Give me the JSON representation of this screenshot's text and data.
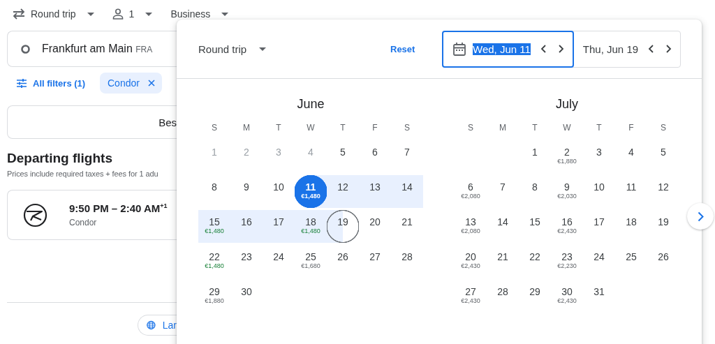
{
  "top_bar": {
    "trip_type": "Round trip",
    "passengers": "1",
    "cabin": "Business"
  },
  "search": {
    "origin": {
      "value": "Frankfurt am Main",
      "code": "FRA"
    }
  },
  "filters": {
    "all_filters": "All filters (1)",
    "chips": [
      {
        "label": "Condor"
      }
    ]
  },
  "sort": {
    "label": "Bes"
  },
  "results": {
    "title": "Departing flights",
    "subtitle": "Prices include required taxes + fees for 1 adu",
    "flights": [
      {
        "times": "9:50 PM – 2:40 AM$^{+1}$",
        "airline": "Condor"
      }
    ]
  },
  "footer": {
    "language_button": "Lar"
  },
  "date_picker": {
    "trip_type": "Round trip",
    "reset": "Reset",
    "fields": [
      {
        "value": "Wed, Jun 11",
        "selected": true
      },
      {
        "value": "Thu, Jun 19",
        "selected": false
      }
    ],
    "months": [
      {
        "name": "June",
        "weekdays": [
          "S",
          "M",
          "T",
          "W",
          "T",
          "F",
          "S"
        ],
        "days": [
          {
            "kind": "day",
            "day": "1",
            "disabled": true,
            "in_range": false,
            "selected": false,
            "outlined": false
          },
          {
            "kind": "day",
            "day": "2",
            "disabled": true,
            "in_range": false,
            "selected": false,
            "outlined": false
          },
          {
            "kind": "day",
            "day": "3",
            "disabled": true,
            "in_range": false,
            "selected": false,
            "outlined": false
          },
          {
            "kind": "day",
            "day": "4",
            "disabled": true,
            "in_range": false,
            "selected": false,
            "outlined": false
          },
          {
            "kind": "day",
            "day": "5",
            "disabled": false,
            "in_range": false,
            "selected": false,
            "outlined": false
          },
          {
            "kind": "day",
            "day": "6",
            "disabled": false,
            "in_range": false,
            "selected": false,
            "outlined": false
          },
          {
            "kind": "day",
            "day": "7",
            "disabled": false,
            "in_range": false,
            "selected": false,
            "outlined": false
          },
          {
            "kind": "day",
            "day": "8",
            "disabled": false,
            "in_range": false,
            "selected": false,
            "outlined": false
          },
          {
            "kind": "day",
            "day": "9",
            "disabled": false,
            "in_range": false,
            "selected": false,
            "outlined": false
          },
          {
            "kind": "day",
            "day": "10",
            "disabled": false,
            "in_range": false,
            "selected": false,
            "outlined": false
          },
          {
            "kind": "day",
            "day": "11",
            "price": {
              "text": "€1,480"
            },
            "disabled": false,
            "in_range": true,
            "selected": true,
            "outlined": false
          },
          {
            "kind": "day",
            "day": "12",
            "disabled": false,
            "in_range": true,
            "selected": false,
            "outlined": false
          },
          {
            "kind": "day",
            "day": "13",
            "disabled": false,
            "in_range": true,
            "selected": false,
            "outlined": false
          },
          {
            "kind": "day",
            "day": "14",
            "disabled": false,
            "in_range": true,
            "selected": false,
            "outlined": false
          },
          {
            "kind": "day",
            "day": "15",
            "price": {
              "text": "€1,480",
              "cheap": true
            },
            "disabled": false,
            "in_range": true,
            "selected": false,
            "outlined": false
          },
          {
            "kind": "day",
            "day": "16",
            "disabled": false,
            "in_range": true,
            "selected": false,
            "outlined": false
          },
          {
            "kind": "day",
            "day": "17",
            "disabled": false,
            "in_range": true,
            "selected": false,
            "outlined": false
          },
          {
            "kind": "day",
            "day": "18",
            "price": {
              "text": "€1,480",
              "cheap": true
            },
            "disabled": false,
            "in_range": true,
            "selected": false,
            "outlined": false
          },
          {
            "kind": "day",
            "day": "19",
            "disabled": false,
            "in_range": true,
            "selected": false,
            "outlined": true
          },
          {
            "kind": "day",
            "day": "20",
            "disabled": false,
            "in_range": false,
            "selected": false,
            "outlined": false
          },
          {
            "kind": "day",
            "day": "21",
            "disabled": false,
            "in_range": false,
            "selected": false,
            "outlined": false
          },
          {
            "kind": "day",
            "day": "22",
            "price": {
              "text": "€1,480",
              "cheap": true
            },
            "disabled": false,
            "in_range": false,
            "selected": false,
            "outlined": false
          },
          {
            "kind": "day",
            "day": "23",
            "disabled": false,
            "in_range": false,
            "selected": false,
            "outlined": false
          },
          {
            "kind": "day",
            "day": "24",
            "disabled": false,
            "in_range": false,
            "selected": false,
            "outlined": false
          },
          {
            "kind": "day",
            "day": "25",
            "price": {
              "text": "€1,680",
              "cheap": false
            },
            "disabled": false,
            "in_range": false,
            "selected": false,
            "outlined": false
          },
          {
            "kind": "day",
            "day": "26",
            "disabled": false,
            "in_range": false,
            "selected": false,
            "outlined": false
          },
          {
            "kind": "day",
            "day": "27",
            "disabled": false,
            "in_range": false,
            "selected": false,
            "outlined": false
          },
          {
            "kind": "day",
            "day": "28",
            "disabled": false,
            "in_range": false,
            "selected": false,
            "outlined": false
          },
          {
            "kind": "day",
            "day": "29",
            "price": {
              "text": "€1,880",
              "cheap": false
            },
            "disabled": false,
            "in_range": false,
            "selected": false,
            "outlined": false
          },
          {
            "kind": "day",
            "day": "30",
            "disabled": false,
            "in_range": false,
            "selected": false,
            "outlined": false
          }
        ]
      },
      {
        "name": "July",
        "weekdays": [
          "S",
          "M",
          "T",
          "W",
          "T",
          "F",
          "S"
        ],
        "days": [
          {
            "kind": "empty"
          },
          {
            "kind": "empty"
          },
          {
            "kind": "day",
            "day": "1",
            "disabled": false,
            "in_range": false,
            "selected": false,
            "outlined": false
          },
          {
            "kind": "day",
            "day": "2",
            "price": {
              "text": "€1,880",
              "cheap": false
            },
            "disabled": false,
            "in_range": false,
            "selected": false,
            "outlined": false
          },
          {
            "kind": "day",
            "day": "3",
            "disabled": false,
            "in_range": false,
            "selected": false,
            "outlined": false
          },
          {
            "kind": "day",
            "day": "4",
            "disabled": false,
            "in_range": false,
            "selected": false,
            "outlined": false
          },
          {
            "kind": "day",
            "day": "5",
            "disabled": false,
            "in_range": false,
            "selected": false,
            "outlined": false
          },
          {
            "kind": "day",
            "day": "6",
            "price": {
              "text": "€2,080",
              "cheap": false
            },
            "disabled": false,
            "in_range": false,
            "selected": false,
            "outlined": false
          },
          {
            "kind": "day",
            "day": "7",
            "disabled": false,
            "in_range": false,
            "selected": false,
            "outlined": false
          },
          {
            "kind": "day",
            "day": "8",
            "disabled": false,
            "in_range": false,
            "selected": false,
            "outlined": false
          },
          {
            "kind": "day",
            "day": "9",
            "price": {
              "text": "€2,030",
              "cheap": false
            },
            "disabled": false,
            "in_range": false,
            "selected": false,
            "outlined": false
          },
          {
            "kind": "day",
            "day": "10",
            "disabled": false,
            "in_range": false,
            "selected": false,
            "outlined": false
          },
          {
            "kind": "day",
            "day": "11",
            "disabled": false,
            "in_range": false,
            "selected": false,
            "outlined": false
          },
          {
            "kind": "day",
            "day": "12",
            "disabled": false,
            "in_range": false,
            "selected": false,
            "outlined": false
          },
          {
            "kind": "day",
            "day": "13",
            "price": {
              "text": "€2,080",
              "cheap": false
            },
            "disabled": false,
            "in_range": false,
            "selected": false,
            "outlined": false
          },
          {
            "kind": "day",
            "day": "14",
            "disabled": false,
            "in_range": false,
            "selected": false,
            "outlined": false
          },
          {
            "kind": "day",
            "day": "15",
            "disabled": false,
            "in_range": false,
            "selected": false,
            "outlined": false
          },
          {
            "kind": "day",
            "day": "16",
            "price": {
              "text": "€2,430",
              "cheap": false
            },
            "disabled": false,
            "in_range": false,
            "selected": false,
            "outlined": false
          },
          {
            "kind": "day",
            "day": "17",
            "disabled": false,
            "in_range": false,
            "selected": false,
            "outlined": false
          },
          {
            "kind": "day",
            "day": "18",
            "disabled": false,
            "in_range": false,
            "selected": false,
            "outlined": false
          },
          {
            "kind": "day",
            "day": "19",
            "disabled": false,
            "in_range": false,
            "selected": false,
            "outlined": false
          },
          {
            "kind": "day",
            "day": "20",
            "price": {
              "text": "€2,430",
              "cheap": false
            },
            "disabled": false,
            "in_range": false,
            "selected": false,
            "outlined": false
          },
          {
            "kind": "day",
            "day": "21",
            "disabled": false,
            "in_range": false,
            "selected": false,
            "outlined": false
          },
          {
            "kind": "day",
            "day": "22",
            "disabled": false,
            "in_range": false,
            "selected": false,
            "outlined": false
          },
          {
            "kind": "day",
            "day": "23",
            "price": {
              "text": "€2,230",
              "cheap": false
            },
            "disabled": false,
            "in_range": false,
            "selected": false,
            "outlined": false
          },
          {
            "kind": "day",
            "day": "24",
            "disabled": false,
            "in_range": false,
            "selected": false,
            "outlined": false
          },
          {
            "kind": "day",
            "day": "25",
            "disabled": false,
            "in_range": false,
            "selected": false,
            "outlined": false
          },
          {
            "kind": "day",
            "day": "26",
            "disabled": false,
            "in_range": false,
            "selected": false,
            "outlined": false
          },
          {
            "kind": "day",
            "day": "27",
            "price": {
              "text": "€2,430",
              "cheap": false
            },
            "disabled": false,
            "in_range": false,
            "selected": false,
            "outlined": false
          },
          {
            "kind": "day",
            "day": "28",
            "disabled": false,
            "in_range": false,
            "selected": false,
            "outlined": false
          },
          {
            "kind": "day",
            "day": "29",
            "disabled": false,
            "in_range": false,
            "selected": false,
            "outlined": false
          },
          {
            "kind": "day",
            "day": "30",
            "price": {
              "text": "€2,430",
              "cheap": false
            },
            "disabled": false,
            "in_range": false,
            "selected": false,
            "outlined": false
          },
          {
            "kind": "day",
            "day": "31",
            "disabled": false,
            "in_range": false,
            "selected": false,
            "outlined": false
          }
        ]
      }
    ]
  }
}
